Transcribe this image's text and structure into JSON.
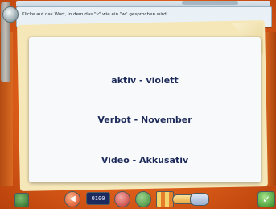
{
  "instruction": "Klicke auf das Wort, in dem das \"v\" wie ein \"w\" gesprochen wird!",
  "options": [
    {
      "label": "aktiv - violett"
    },
    {
      "label": "Verbot - November"
    },
    {
      "label": "Video - Akkusativ"
    }
  ],
  "toolbar": {
    "counter": "0100"
  },
  "colors": {
    "background": "#e56a14",
    "card": "#f7f9fb",
    "paper": "#f6e7b8",
    "text": "#1e2b5a"
  },
  "icons": {
    "home": "house-icon",
    "back": "arrow-left-icon",
    "sound": "speaker-icon",
    "hint": "hint-icon",
    "books": "books-icon",
    "speech": "speech-bubble-icon",
    "confirm": "check-icon"
  }
}
